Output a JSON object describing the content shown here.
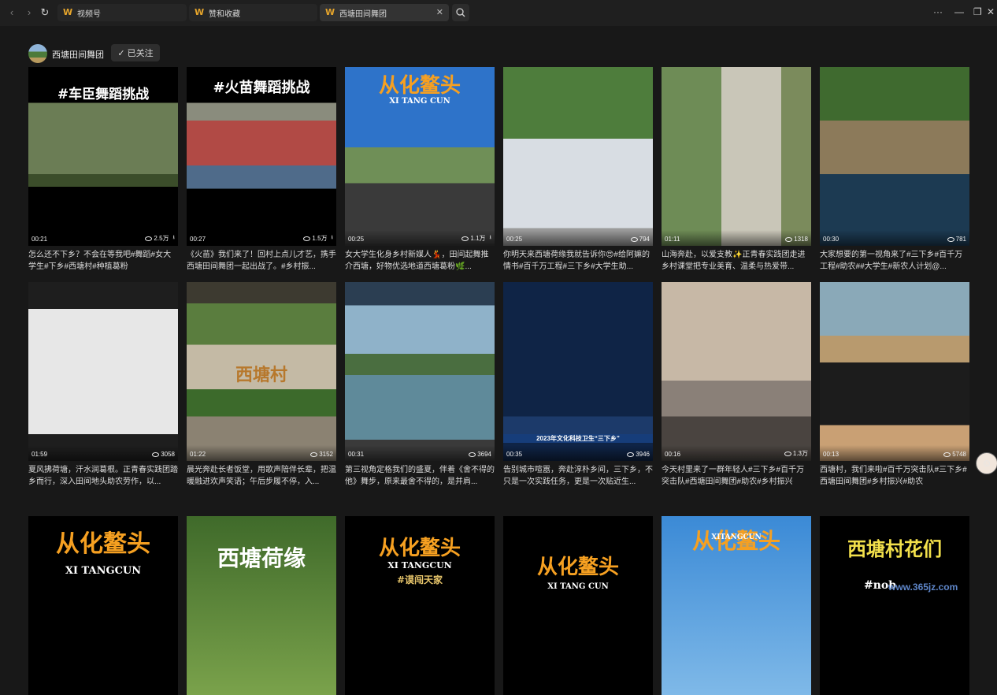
{
  "tabs": [
    {
      "label": "视频号"
    },
    {
      "label": "赞和收藏"
    },
    {
      "label": "西塘田间舞团"
    }
  ],
  "window_controls": {
    "more": "···",
    "minimize": "—",
    "restore": "❐",
    "close": "✕"
  },
  "account": {
    "name": "西塘田间舞团",
    "follow_label": "已关注"
  },
  "videos": [
    {
      "duration": "00:21",
      "views": "2.5万",
      "caption": "怎么还不下乡？不会在等我吧#舞蹈#女大学生#下乡#西塘村#种植葛粉",
      "headline": "#车臣舞蹈挑战"
    },
    {
      "duration": "00:27",
      "views": "1.5万",
      "caption": "《火苗》我们来了！回村上点儿才艺，携手西塘田间舞团一起出战了。#乡村振...",
      "headline": "#火苗舞蹈挑战"
    },
    {
      "duration": "00:25",
      "views": "1.1万",
      "caption": "女大学生化身乡村新媒人💃，田间起舞推介西塘，好物优选地道西塘葛粉🌿...",
      "headline": "从化鳌头",
      "subheadline": "XI TANG CUN"
    },
    {
      "duration": "00:25",
      "views": "794",
      "caption": "你明天来西塘荷缘我就告诉你😍#给阿嫲的情书#百千万工程#三下乡#大学生助...",
      "headline": ""
    },
    {
      "duration": "01:11",
      "views": "1318",
      "caption": "山海奔赴，以爱支教✨正青春实践团走进乡村课堂把专业美育、温柔与热爱带...",
      "headline": ""
    },
    {
      "duration": "00:30",
      "views": "781",
      "caption": "大家想要的第一视角来了#三下乡#百千万工程#助农##大学生#新农人计划@...",
      "headline": ""
    },
    {
      "duration": "01:59",
      "views": "3058",
      "caption": "夏风拂荷塘，汗水润葛根。正青春实践团踏乡而行，深入田间地头助农劳作，以...",
      "headline": ""
    },
    {
      "duration": "01:22",
      "views": "3152",
      "caption": "晨光奔赴长者饭堂，用歌声陪伴长辈，把温暖融进欢声笑语；午后步履不停，入...",
      "headline": "西塘村"
    },
    {
      "duration": "00:31",
      "views": "3694",
      "caption": "第三视角定格我们的盛夏，伴着《舍不得的他》舞步，原来最舍不得的，是并肩...",
      "headline": ""
    },
    {
      "duration": "00:35",
      "views": "3946",
      "caption": "告别城市喧嚣，奔赴淳朴乡间，三下乡，不只是一次实践任务，更是一次贴近生...",
      "headline": "",
      "ticker": "2023年文化科技卫生“三下乡”"
    },
    {
      "duration": "00:16",
      "views": "1.3万",
      "caption": "今天村里来了一群年轻人#三下乡#百千万突击队#西塘田间舞团#助农#乡村振兴",
      "headline": ""
    },
    {
      "duration": "00:13",
      "views": "5748",
      "caption": "西塘村，我们来啦#百千万突击队#三下乡#西塘田间舞团#乡村振兴#助农",
      "headline": ""
    },
    {
      "duration": "",
      "views": "",
      "caption": "",
      "headline": "从化鳌头",
      "subheadline": "XI TANGCUN"
    },
    {
      "duration": "",
      "views": "",
      "caption": "",
      "headline": "西塘荷缘"
    },
    {
      "duration": "",
      "views": "",
      "caption": "",
      "headline": "从化鳌头",
      "subheadline": "XI TANGCUN",
      "tagline": "#谟闯天家"
    },
    {
      "duration": "",
      "views": "",
      "caption": "",
      "headline": "从化鳌头",
      "subheadline": "XI TANG CUN"
    },
    {
      "duration": "",
      "views": "",
      "caption": "",
      "headline": "从化鳌头",
      "subheadline": "XITANGCUN"
    },
    {
      "duration": "",
      "views": "",
      "caption": "",
      "headline": "西塘村花们",
      "tagline": "#nob"
    }
  ],
  "watermark": "www.365jz.com",
  "colors": {
    "background": "#181818",
    "titlebar": "#1f1f1f",
    "logo": "#e6a52b",
    "headline_orange": "#f6a021",
    "headline_yellow": "#f2e04b"
  }
}
